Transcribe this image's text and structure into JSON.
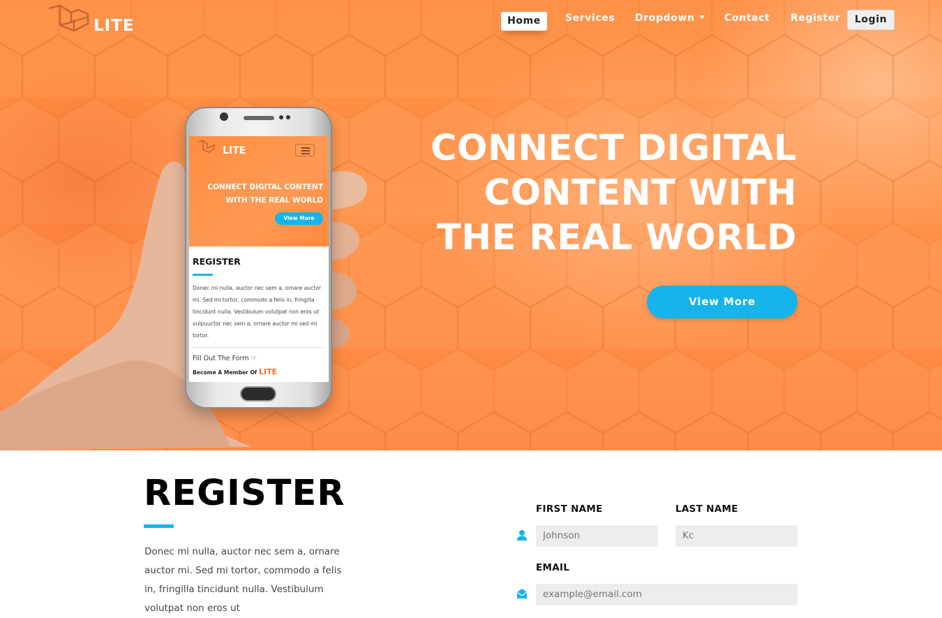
{
  "brand": {
    "name": "LITE"
  },
  "nav": {
    "items": [
      "Home",
      "Services",
      "Dropdown",
      "Contact",
      "Register"
    ],
    "login_label": "Login",
    "active": "Home"
  },
  "hero": {
    "title_lines": [
      "CONNECT DIGITAL",
      "CONTENT WITH",
      "THE REAL WORLD"
    ],
    "button_label": "View More",
    "accent_color": "#15b4ea",
    "background_color": "#ff8a3d"
  },
  "phone_screen": {
    "logo_text": "LITE",
    "title_lines": [
      "CONNECT DIGITAL CONTENT",
      "WITH THE REAL WORLD"
    ],
    "button_label": "View More",
    "register_heading": "REGISTER",
    "paragraph": "Donec mi nulla, auctor nec sem a, ornare auctor mi. Sed mi tortor, commodo a felis in, fringilla tincidunt nulla. Vestibulum volutpat non eros ut vulpuuctor nec sem a, ornare auctor mi sed mi tortor.",
    "fill_out_label": "Fill Out The Form",
    "member_label": "Become A Member Of",
    "member_brand": "LITE"
  },
  "register": {
    "heading": "REGISTER",
    "paragraph": "Donec mi nulla, auctor nec sem a, ornare auctor mi. Sed mi tortor, commodo a felis in, fringilla tincidunt nulla. Vestibulum volutpat non eros ut",
    "first_name": {
      "label": "FIRST NAME",
      "placeholder": "Johnson"
    },
    "last_name": {
      "label": "LAST NAME",
      "placeholder": "Kc"
    },
    "email": {
      "label": "EMAIL",
      "placeholder": "example@email.com"
    }
  }
}
